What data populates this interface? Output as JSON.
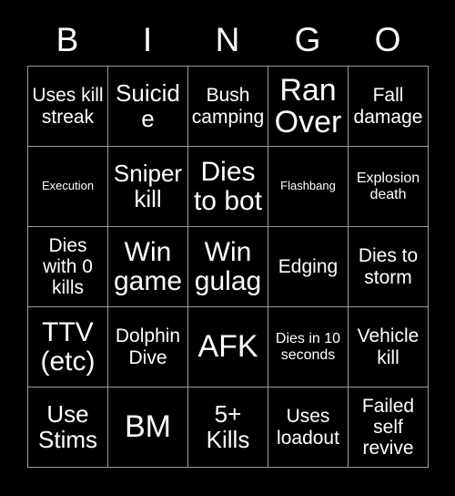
{
  "card": {
    "title": "BINGO",
    "header_letters": [
      "B",
      "I",
      "N",
      "G",
      "O"
    ],
    "colors": {
      "background": "#000000",
      "text": "#ffffff",
      "grid_line": "#9a9a9a"
    },
    "rows": [
      [
        {
          "text": "Uses kill streak",
          "size": "md"
        },
        {
          "text": "Suicide",
          "size": "lg"
        },
        {
          "text": "Bush camping",
          "size": "md"
        },
        {
          "text": "Ran Over",
          "size": "xxl"
        },
        {
          "text": "Fall damage",
          "size": "md"
        }
      ],
      [
        {
          "text": "Execution",
          "size": "xs"
        },
        {
          "text": "Sniper kill",
          "size": "lg"
        },
        {
          "text": "Dies to bot",
          "size": "xl"
        },
        {
          "text": "Flashbang",
          "size": "xs"
        },
        {
          "text": "Explosion death",
          "size": "sm"
        }
      ],
      [
        {
          "text": "Dies with 0 kills",
          "size": "md"
        },
        {
          "text": "Win game",
          "size": "xl"
        },
        {
          "text": "Win gulag",
          "size": "xl"
        },
        {
          "text": "Edging",
          "size": "md"
        },
        {
          "text": "Dies to storm",
          "size": "md"
        }
      ],
      [
        {
          "text": "TTV (etc)",
          "size": "xl"
        },
        {
          "text": "Dolphin Dive",
          "size": "md"
        },
        {
          "text": "AFK",
          "size": "xxl"
        },
        {
          "text": "Dies in 10 seconds",
          "size": "sm"
        },
        {
          "text": "Vehicle kill",
          "size": "md"
        }
      ],
      [
        {
          "text": "Use Stims",
          "size": "lg"
        },
        {
          "text": "BM",
          "size": "xxl"
        },
        {
          "text": "5+ Kills",
          "size": "lg"
        },
        {
          "text": "Uses loadout",
          "size": "md"
        },
        {
          "text": "Failed self revive",
          "size": "md"
        }
      ]
    ]
  }
}
